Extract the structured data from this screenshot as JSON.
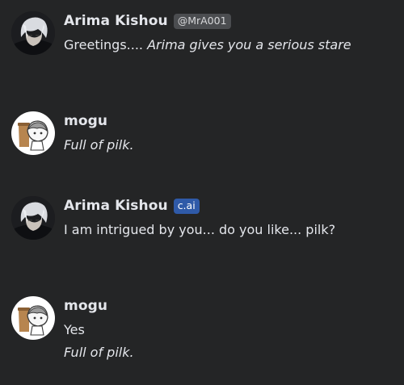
{
  "messages": [
    {
      "name": "Arima Kishou",
      "badge": "@MrA001",
      "text_plain": "Greetings.... ",
      "text_italic": "Arima gives you a serious stare"
    },
    {
      "name": "mogu",
      "text_italic": "Full of pilk."
    },
    {
      "name": "Arima Kishou",
      "badge": "c.ai",
      "text_plain": "I am intrigued by you... do you like... pilk?"
    },
    {
      "name": "mogu",
      "text_plain": "Yes",
      "text_italic": "Full of pilk."
    }
  ],
  "colors": {
    "background": "#242526",
    "text": "#e4e6eb",
    "handle_badge": "#4b4d50",
    "cai_badge": "#2f5aa8"
  },
  "icons": {
    "arima_avatar": "arima-avatar-icon",
    "mogu_avatar": "mogu-avatar-icon"
  }
}
